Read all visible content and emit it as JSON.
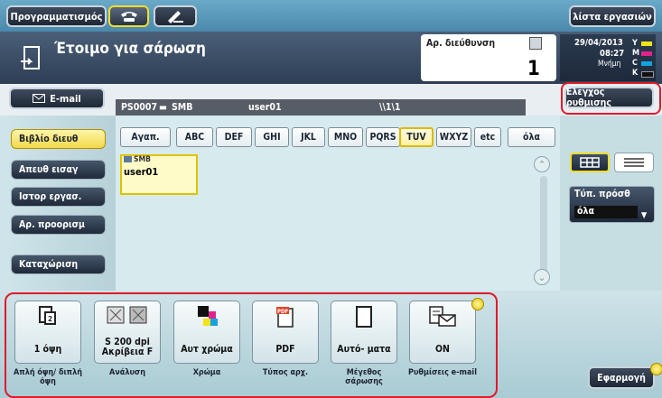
{
  "topbar": {
    "program_label": "Προγραμματισμός",
    "phone_icon": "phone-icon",
    "pen_icon": "pen-icon",
    "jobs_label": "λίστα εργασιών"
  },
  "status": {
    "title": "Έτοιμο για σάρωση",
    "addr_label": "Αρ. διεύθυνση",
    "addr_count": "1",
    "date": "29/04/2013",
    "time": "08:27",
    "memory_label": "Μνήμη",
    "toner": [
      {
        "letter": "Y",
        "color": "#f2e21a"
      },
      {
        "letter": "M",
        "color": "#e0238c"
      },
      {
        "letter": "C",
        "color": "#12a3e0"
      },
      {
        "letter": "K",
        "color": "#111111"
      }
    ]
  },
  "tabrow": {
    "email_label": "E-mail",
    "dest_id": "PS0007",
    "dest_type": "SMB",
    "dest_user": "user01",
    "dest_path": "\\\\1\\1",
    "check_label": "Ελεγχος ρυθμισης"
  },
  "sidebar": {
    "items": [
      {
        "label": "Βιβλίο διευθ",
        "active": true
      },
      {
        "label": "Απευθ εισαγ",
        "active": false
      },
      {
        "label": "Ιστορ εργασ.",
        "active": false
      },
      {
        "label": "Αρ. προορισμ",
        "active": false
      }
    ],
    "register_label": "Καταχώριση"
  },
  "filters": [
    "Αγαπ.",
    "ABC",
    "DEF",
    "GHI",
    "JKL",
    "MNO",
    "PQRS",
    "TUV",
    "WXYZ",
    "etc",
    "όλα"
  ],
  "active_filter": "TUV",
  "entry": {
    "type": "SMB",
    "name": "user01"
  },
  "search": {
    "label": "Τύπ. πρόσθ",
    "value": "όλα"
  },
  "tiles": [
    {
      "value": "1 όψη",
      "caption": "Απλή όψη/ διπλή όψη",
      "icon": "single-side-icon"
    },
    {
      "value": "S 200 dpi Ακρίβεια F",
      "caption": "Ανάλυση",
      "icon": "resolution-icon"
    },
    {
      "value": "Αυτ χρώμα",
      "caption": "Χρώμα",
      "icon": "color-icon"
    },
    {
      "value": "PDF",
      "caption": "Τύπος αρχ.",
      "icon": "pdf-icon"
    },
    {
      "value": "Αυτό- ματα",
      "caption": "Μέγεθος σάρωσης",
      "icon": "page-icon"
    },
    {
      "value": "ON",
      "caption": "Ρυθμίσεις e-mail",
      "icon": "email-settings-icon"
    }
  ],
  "apply_label": "Εφαρμογή"
}
